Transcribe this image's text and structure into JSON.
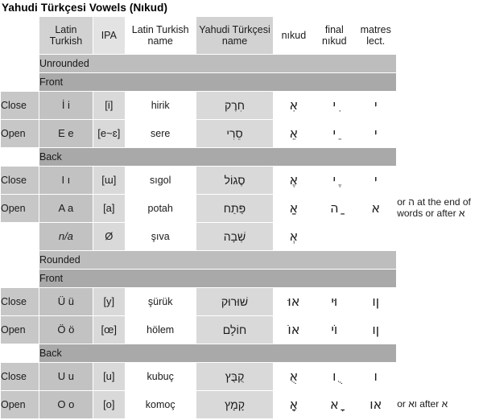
{
  "title": "Yahudi Türkçesi Vowels (Nıkud)",
  "columns": {
    "position": "",
    "latin_turkish": "Latin Turkish",
    "ipa": "IPA",
    "latin_turkish_name": "Latin Turkish name",
    "yahudi_turkcesi_name": "Yahudi Türkçesi name",
    "nikud": "nıkud",
    "final_nikud": "final nıkud",
    "matres_lect": "matres lect.",
    "notes": ""
  },
  "sections": [
    {
      "band": "Unrounded",
      "groups": [
        {
          "band": "Front",
          "rows": [
            {
              "position": "Close",
              "latin": "İ i",
              "ipa": "[i]",
              "latin_name": "hirik",
              "yt_name": "חִרֶק",
              "nikud": "אִ",
              "final_nikud": "ִי",
              "matres": "י",
              "note": ""
            },
            {
              "position": "Open",
              "latin": "E e",
              "ipa": "[e~ɛ]",
              "latin_name": "sere",
              "yt_name": "סֵרִי",
              "nikud": "אֵ",
              "final_nikud": "ֵי",
              "matres": "י",
              "note": ""
            }
          ]
        },
        {
          "band": "Back",
          "rows": [
            {
              "position": "Close",
              "latin": "I ı",
              "ipa": "[ɯ]",
              "latin_name": "sıgol",
              "yt_name": "סֶגוֹל",
              "nikud": "אֶ",
              "final_nikud": "ֶי",
              "matres": "י",
              "note": ""
            },
            {
              "position": "Open",
              "latin": "A a",
              "ipa": "[a]",
              "latin_name": "potah",
              "yt_name": "פַּתַח",
              "nikud": "אַ",
              "final_nikud": "ַה",
              "matres": "א",
              "note": "or ה at the end of words or after א"
            },
            {
              "position": "",
              "latin": "n/a",
              "ipa": "Ø",
              "latin_name": "şıva",
              "yt_name": "שְׁבָה",
              "nikud": "אְ",
              "final_nikud": "",
              "matres": "",
              "note": ""
            }
          ]
        }
      ]
    },
    {
      "band": "Rounded",
      "groups": [
        {
          "band": "Front",
          "rows": [
            {
              "position": "Close",
              "latin": "Ü ü",
              "ipa": "[y]",
              "latin_name": "şürük",
              "yt_name": "שׁוּרוּק",
              "nikud": "אוּ",
              "final_nikud": "וּי",
              "matres": "ןו",
              "note": ""
            },
            {
              "position": "Open",
              "latin": "Ö ö",
              "ipa": "[œ]",
              "latin_name": "hölem",
              "yt_name": "חוֹלָם",
              "nikud": "אוֹ",
              "final_nikud": "וֹי",
              "matres": "ןו",
              "note": ""
            }
          ]
        },
        {
          "band": "Back",
          "rows": [
            {
              "position": "Close",
              "latin": "U u",
              "ipa": "[u]",
              "latin_name": "kubuç",
              "yt_name": "קֻבֻּץ",
              "nikud": "אֻ",
              "final_nikud": "ֻו",
              "matres": "ו",
              "note": ""
            },
            {
              "position": "Open",
              "latin": "O o",
              "ipa": "[o]",
              "latin_name": "komoç",
              "yt_name": "קָמָץ",
              "nikud": "אָ",
              "final_nikud": "ָא",
              "matres": "או",
              "note": "or וא after א"
            }
          ]
        }
      ]
    }
  ]
}
